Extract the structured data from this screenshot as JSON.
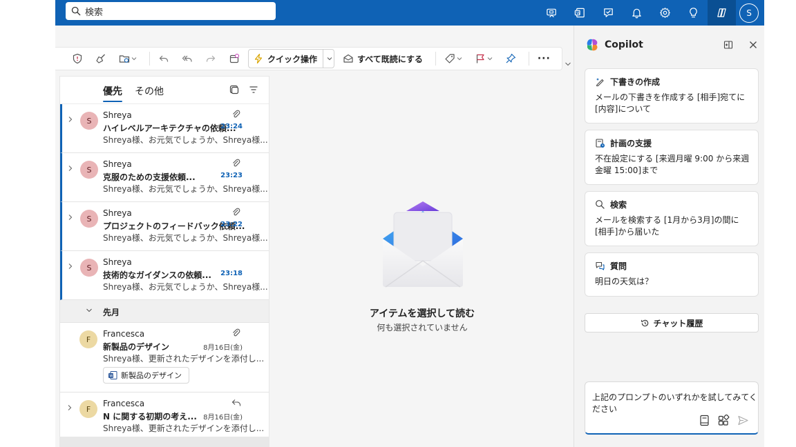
{
  "search": {
    "placeholder": "検索"
  },
  "topbar": {
    "icons": [
      "meet-now-icon",
      "teams-icon",
      "whats-new-icon",
      "bell-icon",
      "gear-icon",
      "lightbulb-icon",
      "copilot-icon"
    ],
    "avatar_initial": "S"
  },
  "ribbon": {
    "quick_actions": "クイック操作",
    "mark_all_read": "すべて既読にする",
    "more": "···"
  },
  "mail_list": {
    "tabs": {
      "focused": "優先",
      "other": "その他"
    },
    "items": [
      {
        "initial": "S",
        "sender": "Shreya",
        "subject": "ハイレベルアーキテクチャの依頼...",
        "preview": "Shreya様、お元気でしょうか、Shreya様...",
        "time": "23:24"
      },
      {
        "initial": "S",
        "sender": "Shreya",
        "subject": "克服のための支援依頼...",
        "preview": "Shreya様、お元気でしょうか、Shreya様...",
        "time": "23:23"
      },
      {
        "initial": "S",
        "sender": "Shreya",
        "subject": "プロジェクトのフィードバック依頼...",
        "preview": "Shreya様、お元気でしょうか、Shreya様...",
        "time": "23:22"
      },
      {
        "initial": "S",
        "sender": "Shreya",
        "subject": "技術的なガイダンスの依頼...",
        "preview": "Shreya様、お元気でしょうか、Shreya様...",
        "time": "23:18"
      }
    ],
    "section_label": "先月",
    "older_items": [
      {
        "initial": "F",
        "sender": "Francesca",
        "subject": "新製品のデザイン",
        "preview": "Shreya様、更新されたデザインを添付し...",
        "date": "8月16日(金)",
        "attachment": "新製品のデザイン"
      },
      {
        "initial": "F",
        "sender": "Francesca",
        "subject": "N に関する初期の考え...",
        "preview": "Shreya様、更新されたデザインを添付し...",
        "date": "8月16日(金)"
      }
    ]
  },
  "reading_pane": {
    "title": "アイテムを選択して読む",
    "subtitle": "何も選択されていません"
  },
  "copilot": {
    "title": "Copilot",
    "cards": [
      {
        "title": "下書きの作成",
        "body": "メールの下書きを作成する [相手]宛てに[内容]について"
      },
      {
        "title": "計画の支援",
        "body": "不在設定にする [来週月曜 9:00 から来週金曜 15:00]まで"
      },
      {
        "title": "検索",
        "body": "メールを検索する [1月から3月]の間に[相手]から届いた"
      },
      {
        "title": "質問",
        "body": "明日の天気は？"
      }
    ],
    "history_button": "チャット履歴",
    "composer_placeholder": "上記のプロンプトのいずれかを試してみてください"
  }
}
